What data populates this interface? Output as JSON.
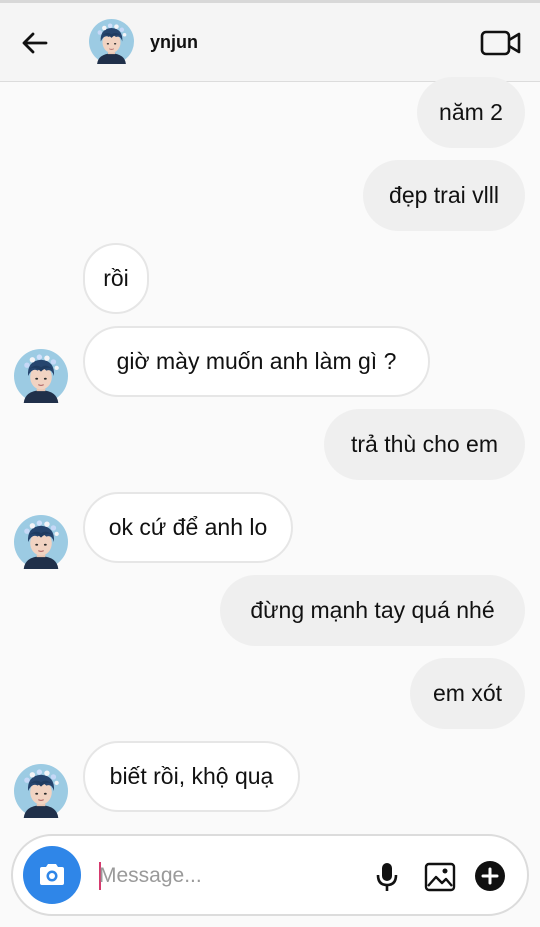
{
  "header": {
    "username": "ynjun"
  },
  "messages": [
    {
      "direction": "out",
      "text": "năm 2"
    },
    {
      "direction": "out",
      "text": "đẹp trai vlll"
    },
    {
      "direction": "in",
      "text": "rồi"
    },
    {
      "direction": "in",
      "text": "giờ mày muốn anh làm gì ?"
    },
    {
      "direction": "out",
      "text": "trả thù cho em"
    },
    {
      "direction": "in",
      "text": "ok cứ để anh lo"
    },
    {
      "direction": "out",
      "text": "đừng mạnh tay quá nhé"
    },
    {
      "direction": "out",
      "text": "em xót"
    },
    {
      "direction": "in",
      "text": "biết rồi, khộ quạ"
    }
  ],
  "composer": {
    "placeholder": "Message..."
  },
  "colors": {
    "camera_button": "#2f86e8",
    "caret": "#d63a6e",
    "outgoing_bubble": "#efefef",
    "incoming_bubble": "#ffffff"
  },
  "icons": {
    "back": "arrow-left-icon",
    "video_call": "video-camera-icon",
    "camera": "camera-icon",
    "microphone": "microphone-icon",
    "gallery": "image-icon",
    "add": "plus-circle-icon"
  }
}
